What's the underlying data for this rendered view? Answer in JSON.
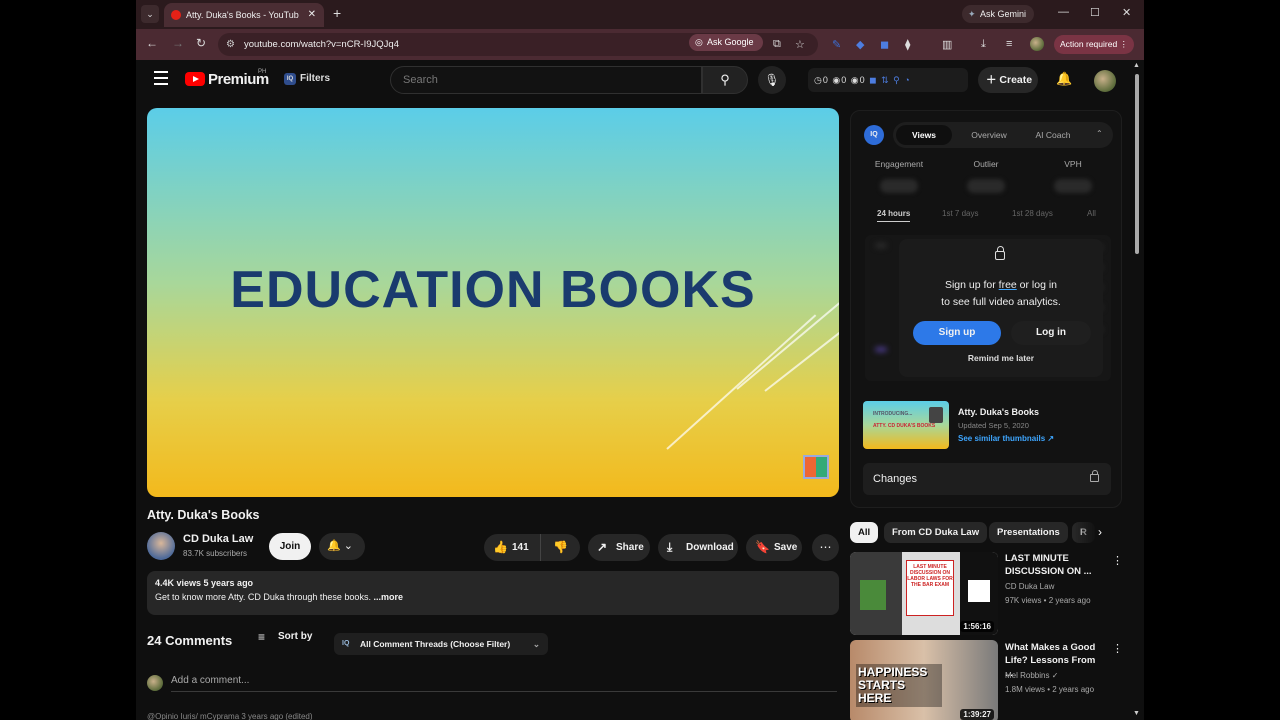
{
  "browser": {
    "tab_title": "Atty. Duka's Books - YouTub",
    "new_tab_icon": "+",
    "ask_gemini": "Ask Gemini",
    "url": "youtube.com/watch?v=nCR-I9JQJq4",
    "ask_google": "Ask Google",
    "action_required": "Action required"
  },
  "header": {
    "brand": "Premium",
    "region": "PH",
    "filters_label": "Filters",
    "search_placeholder": "Search",
    "stats": "◷0 ◉0 ◉0",
    "create_label": "Create"
  },
  "video": {
    "frame_text": "EDUCATION BOOKS",
    "title": "Atty. Duka's Books",
    "channel": "CD Duka Law",
    "subscribers": "83.7K subscribers",
    "join_label": "Join",
    "likes": "141",
    "share_label": "Share",
    "download_label": "Download",
    "save_label": "Save",
    "meta": "4.4K views  5 years ago",
    "description": "Get to know more Atty. CD Duka through these books.",
    "more_label": " ...more"
  },
  "comments": {
    "count_label": "24 Comments",
    "sort_label": "Sort by",
    "filter_label": "All Comment Threads (Choose Filter)",
    "add_placeholder": "Add a comment...",
    "cutoff_text": "@Opinio Iuris/ mCyprama  3 years ago (edited)"
  },
  "vidiq": {
    "logo": "IQ",
    "tabs": [
      "Views",
      "Overview",
      "AI Coach"
    ],
    "metrics": [
      "Engagement",
      "Outlier",
      "VPH"
    ],
    "ranges": [
      "24 hours",
      "1st 7 days",
      "1st 28 days",
      "All"
    ],
    "lock_line1_a": "Sign up for ",
    "lock_line1_free": "free",
    "lock_line1_b": " or log in",
    "lock_line2": "to see full video analytics.",
    "signup_label": "Sign up",
    "login_label": "Log in",
    "remind_label": "Remind me later",
    "thumb_title": "Atty. Duka's Books",
    "thumb_updated": "Updated Sep 5, 2020",
    "thumb_link": "See similar thumbnails ↗",
    "thumb_intro": "INTRODUCING...",
    "thumb_text": "ATTY. CD DUKA'S BOOKS",
    "changes_label": "Changes"
  },
  "chips": [
    "All",
    "From CD Duka Law",
    "Presentations",
    "R"
  ],
  "recommendations": [
    {
      "title": "LAST MINUTE DISCUSSION ON ...",
      "channel": "CD Duka Law",
      "meta": "97K views • 2 years ago",
      "duration": "1:56:16",
      "thumb_text": "LAST MINUTE DISCUSSION ON LABOR LAWS FOR THE BAR EXAM"
    },
    {
      "title": "What Makes a Good Life? Lessons From ...",
      "channel": "Mel Robbins ✓",
      "meta": "1.8M views • 2 years ago",
      "duration": "1:39:27",
      "thumb_text": "HAPPINESS STARTS HERE"
    }
  ],
  "colors": {
    "accent_blue": "#2d79e8",
    "yt_red": "#ff0000",
    "frame_title": "#1a3b6e",
    "link_blue": "#3ea6ff"
  }
}
